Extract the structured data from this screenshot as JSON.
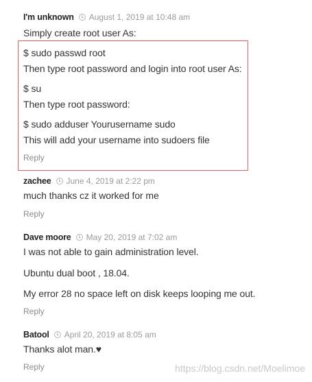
{
  "comments": [
    {
      "author": "I'm unknown",
      "date": "August 1, 2019 at 10:48 am",
      "lines": [
        "Simply create root user As:",
        "$ sudo passwd root",
        "Then type root password and login into root user As:",
        "$ su",
        "Then type root password:",
        "$ sudo adduser Yourusername sudo",
        "This will add your username into sudoers file"
      ],
      "reply": "Reply"
    },
    {
      "author": "zachee",
      "date": "June 4, 2019 at 2:22 pm",
      "lines": [
        "much thanks cz it worked for me"
      ],
      "reply": "Reply"
    },
    {
      "author": "Dave moore",
      "date": "May 20, 2019 at 7:02 am",
      "lines": [
        "I was not able to gain administration level.",
        "Ubuntu dual boot , 18.04.",
        "My error 28 no space left on disk keeps looping me out."
      ],
      "reply": "Reply"
    },
    {
      "author": "Batool",
      "date": "April 20, 2019 at 8:05 am",
      "lines": [
        "Thanks alot man.♥"
      ],
      "reply": "Reply"
    }
  ],
  "watermark": "https://blog.csdn.net/Moelimoe",
  "colors": {
    "highlight_border": "#e06060",
    "meta_text": "#9a9a9a",
    "body_text": "#333333"
  },
  "icons": {
    "date": "clock-icon"
  }
}
